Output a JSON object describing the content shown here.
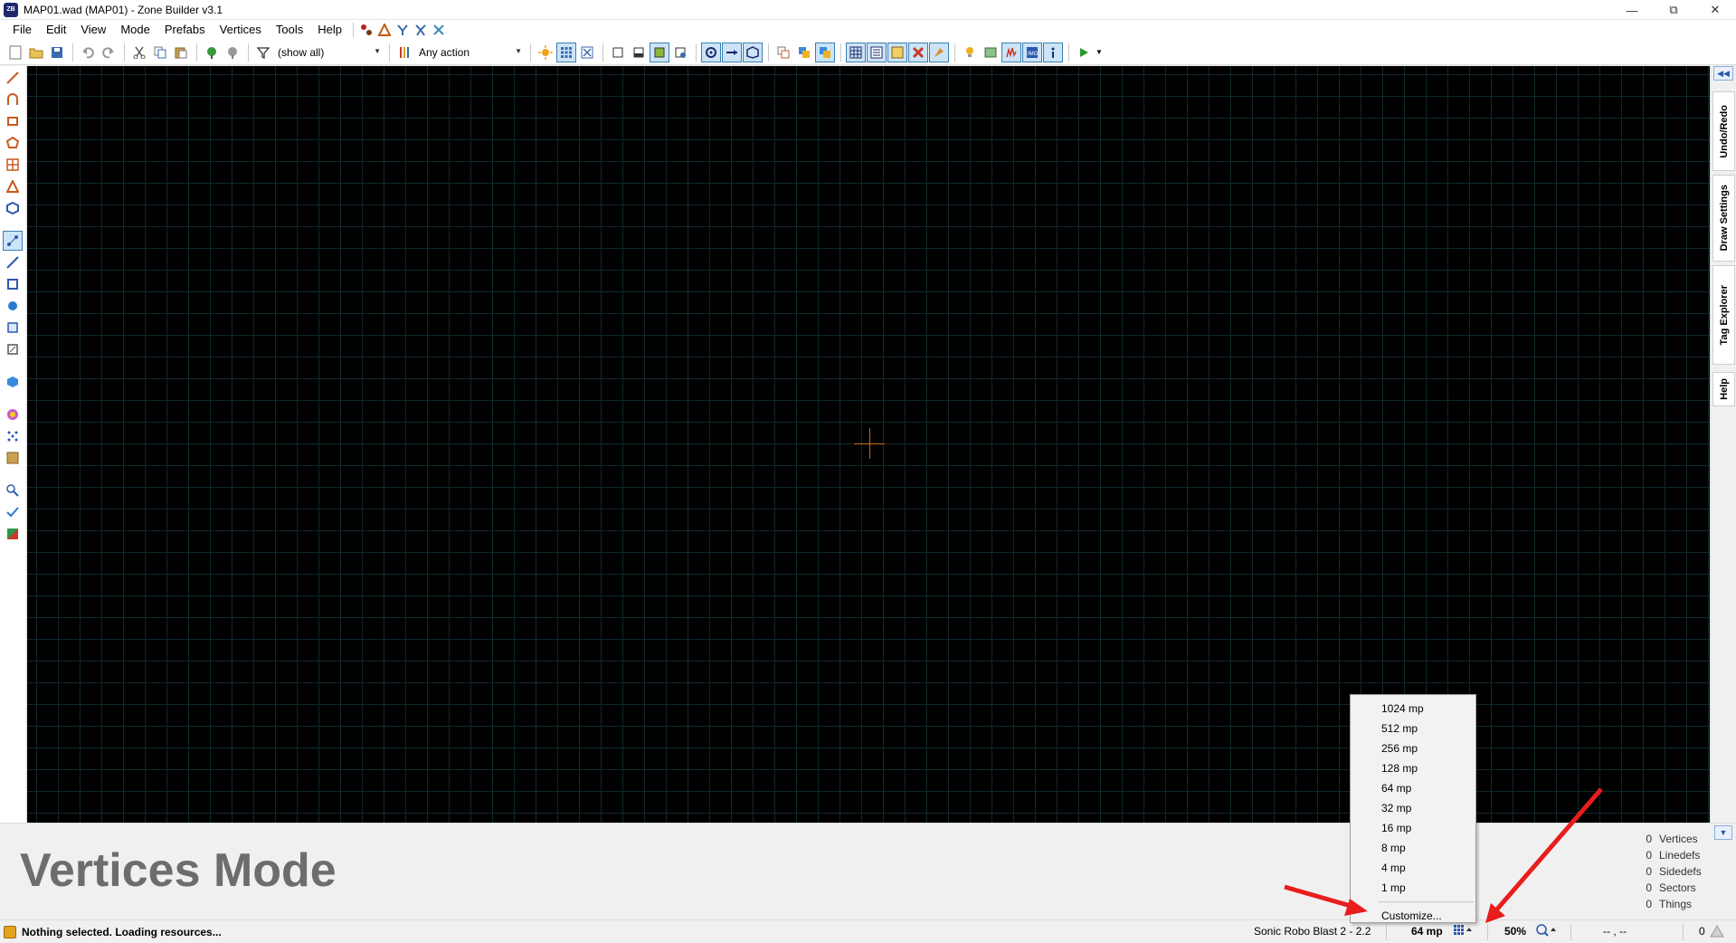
{
  "window": {
    "title": "MAP01.wad (MAP01) - Zone Builder v3.1",
    "app_icon_text": "ZB"
  },
  "menubar": {
    "items": [
      "File",
      "Edit",
      "View",
      "Mode",
      "Prefabs",
      "Vertices",
      "Tools",
      "Help"
    ]
  },
  "toolbar": {
    "filter_label": "(show all)",
    "action_label": "Any action"
  },
  "dock_tabs": [
    "Undo/Redo",
    "Draw Settings",
    "Tag Explorer",
    "Help"
  ],
  "info_panel": {
    "mode_title": "Vertices Mode",
    "counts": [
      {
        "num": "0",
        "label": "Vertices"
      },
      {
        "num": "0",
        "label": "Linedefs"
      },
      {
        "num": "0",
        "label": "Sidedefs"
      },
      {
        "num": "0",
        "label": "Sectors"
      },
      {
        "num": "0",
        "label": "Things"
      }
    ]
  },
  "statusbar": {
    "message": "Nothing selected. Loading resources...",
    "game_config": "Sonic Robo Blast 2 - 2.2",
    "grid_size": "64 mp",
    "zoom": "50%",
    "coords": "-- , --",
    "right_value": "0"
  },
  "grid_menu": {
    "items": [
      "1024 mp",
      "512 mp",
      "256 mp",
      "128 mp",
      "64 mp",
      "32 mp",
      "16 mp",
      "8 mp",
      "4 mp",
      "1 mp"
    ],
    "customize": "Customize..."
  },
  "colors": {
    "canvas_bg": "#000000",
    "grid_line": "#10282f",
    "crosshair": "#c86a1e",
    "annotation_arrow": "#e81d1d"
  }
}
